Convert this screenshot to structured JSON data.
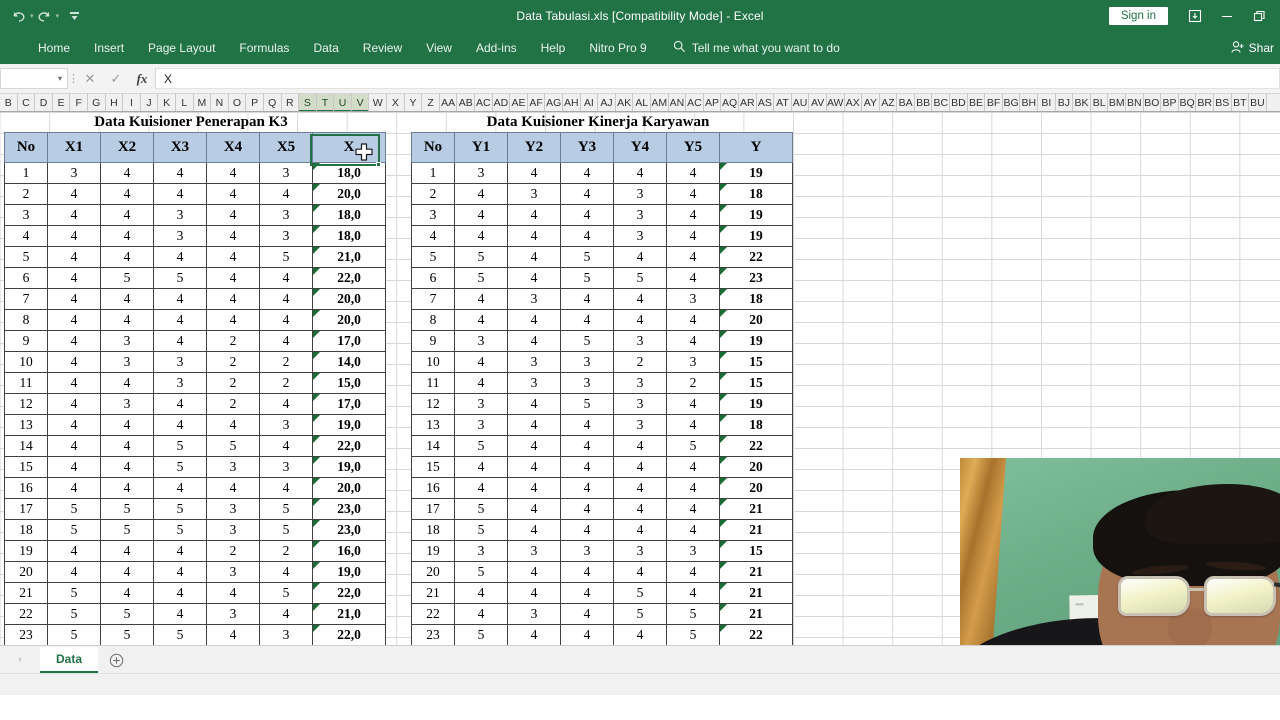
{
  "titlebar": {
    "document_title": "Data Tabulasi.xls  [Compatibility Mode]  -  Excel",
    "undo_icon": "↶",
    "redo_icon": "↷",
    "customize_icon": "�businessdown",
    "sign_in_label": "Sign in",
    "ribbon_display_icon": "ribbon-display-options",
    "minimize_icon": "minimize",
    "restore_icon": "restore"
  },
  "ribbon": {
    "tabs": [
      "Home",
      "Insert",
      "Page Layout",
      "Formulas",
      "Data",
      "Review",
      "View",
      "Add-ins",
      "Help",
      "Nitro Pro 9"
    ],
    "tell_me_placeholder": "Tell me what you want to do",
    "share_label": "Shar"
  },
  "formula_bar": {
    "name_box_value": "",
    "cancel_icon": "✕",
    "enter_icon": "✓",
    "fx_icon": "fx",
    "formula_value": "X"
  },
  "grid": {
    "column_headers": [
      "B",
      "C",
      "D",
      "E",
      "F",
      "G",
      "H",
      "I",
      "J",
      "K",
      "L",
      "M",
      "N",
      "O",
      "P",
      "Q",
      "R",
      "S",
      "T",
      "U",
      "V",
      "W",
      "X",
      "Y",
      "Z",
      "AA",
      "AB",
      "AC",
      "AD",
      "AE",
      "AF",
      "AG",
      "AH",
      "AI",
      "AJ",
      "AK",
      "AL",
      "AM",
      "AN",
      "AC",
      "AP",
      "AQ",
      "AR",
      "AS",
      "AT",
      "AU",
      "AV",
      "AW",
      "AX",
      "AY",
      "AZ",
      "BA",
      "BB",
      "BC",
      "BD",
      "BE",
      "BF",
      "BG",
      "BH",
      "BI",
      "BJ",
      "BK",
      "BL",
      "BM",
      "BN",
      "BO",
      "BP",
      "BQ",
      "BR",
      "BS",
      "BT",
      "BU"
    ],
    "selected_columns": [
      "S",
      "T",
      "U",
      "V"
    ],
    "selected_cell_text": "X"
  },
  "tables": [
    {
      "title": "Data Kuisioner Penerapan K3",
      "headers": [
        "No",
        "X1",
        "X2",
        "X3",
        "X4",
        "X5",
        "X"
      ],
      "total_style": "yellow",
      "rows": [
        [
          "1",
          "3",
          "4",
          "4",
          "4",
          "3",
          "18,0"
        ],
        [
          "2",
          "4",
          "4",
          "4",
          "4",
          "4",
          "20,0"
        ],
        [
          "3",
          "4",
          "4",
          "3",
          "4",
          "3",
          "18,0"
        ],
        [
          "4",
          "4",
          "4",
          "3",
          "4",
          "3",
          "18,0"
        ],
        [
          "5",
          "4",
          "4",
          "4",
          "4",
          "5",
          "21,0"
        ],
        [
          "6",
          "4",
          "5",
          "5",
          "4",
          "4",
          "22,0"
        ],
        [
          "7",
          "4",
          "4",
          "4",
          "4",
          "4",
          "20,0"
        ],
        [
          "8",
          "4",
          "4",
          "4",
          "4",
          "4",
          "20,0"
        ],
        [
          "9",
          "4",
          "3",
          "4",
          "2",
          "4",
          "17,0"
        ],
        [
          "10",
          "4",
          "3",
          "3",
          "2",
          "2",
          "14,0"
        ],
        [
          "11",
          "4",
          "4",
          "3",
          "2",
          "2",
          "15,0"
        ],
        [
          "12",
          "4",
          "3",
          "4",
          "2",
          "4",
          "17,0"
        ],
        [
          "13",
          "4",
          "4",
          "4",
          "4",
          "3",
          "19,0"
        ],
        [
          "14",
          "4",
          "4",
          "5",
          "5",
          "4",
          "22,0"
        ],
        [
          "15",
          "4",
          "4",
          "5",
          "3",
          "3",
          "19,0"
        ],
        [
          "16",
          "4",
          "4",
          "4",
          "4",
          "4",
          "20,0"
        ],
        [
          "17",
          "5",
          "5",
          "5",
          "3",
          "5",
          "23,0"
        ],
        [
          "18",
          "5",
          "5",
          "5",
          "3",
          "5",
          "23,0"
        ],
        [
          "19",
          "4",
          "4",
          "4",
          "2",
          "2",
          "16,0"
        ],
        [
          "20",
          "4",
          "4",
          "4",
          "3",
          "4",
          "19,0"
        ],
        [
          "21",
          "5",
          "4",
          "4",
          "4",
          "5",
          "22,0"
        ],
        [
          "22",
          "5",
          "5",
          "4",
          "3",
          "4",
          "21,0"
        ],
        [
          "23",
          "5",
          "5",
          "5",
          "4",
          "3",
          "22,0"
        ]
      ]
    },
    {
      "title": "Data Kuisioner Kinerja Karyawan",
      "headers": [
        "No",
        "Y1",
        "Y2",
        "Y3",
        "Y4",
        "Y5",
        "Y"
      ],
      "total_style": "green",
      "rows": [
        [
          "1",
          "3",
          "4",
          "4",
          "4",
          "4",
          "19"
        ],
        [
          "2",
          "4",
          "3",
          "4",
          "3",
          "4",
          "18"
        ],
        [
          "3",
          "4",
          "4",
          "4",
          "3",
          "4",
          "19"
        ],
        [
          "4",
          "4",
          "4",
          "4",
          "3",
          "4",
          "19"
        ],
        [
          "5",
          "5",
          "4",
          "5",
          "4",
          "4",
          "22"
        ],
        [
          "6",
          "5",
          "4",
          "5",
          "5",
          "4",
          "23"
        ],
        [
          "7",
          "4",
          "3",
          "4",
          "4",
          "3",
          "18"
        ],
        [
          "8",
          "4",
          "4",
          "4",
          "4",
          "4",
          "20"
        ],
        [
          "9",
          "3",
          "4",
          "5",
          "3",
          "4",
          "19"
        ],
        [
          "10",
          "4",
          "3",
          "3",
          "2",
          "3",
          "15"
        ],
        [
          "11",
          "4",
          "3",
          "3",
          "3",
          "2",
          "15"
        ],
        [
          "12",
          "3",
          "4",
          "5",
          "3",
          "4",
          "19"
        ],
        [
          "13",
          "3",
          "4",
          "4",
          "3",
          "4",
          "18"
        ],
        [
          "14",
          "5",
          "4",
          "4",
          "4",
          "5",
          "22"
        ],
        [
          "15",
          "4",
          "4",
          "4",
          "4",
          "4",
          "20"
        ],
        [
          "16",
          "4",
          "4",
          "4",
          "4",
          "4",
          "20"
        ],
        [
          "17",
          "5",
          "4",
          "4",
          "4",
          "4",
          "21"
        ],
        [
          "18",
          "5",
          "4",
          "4",
          "4",
          "4",
          "21"
        ],
        [
          "19",
          "3",
          "3",
          "3",
          "3",
          "3",
          "15"
        ],
        [
          "20",
          "5",
          "4",
          "4",
          "4",
          "4",
          "21"
        ],
        [
          "21",
          "4",
          "4",
          "4",
          "5",
          "4",
          "21"
        ],
        [
          "22",
          "4",
          "3",
          "4",
          "5",
          "5",
          "21"
        ],
        [
          "23",
          "5",
          "4",
          "4",
          "4",
          "5",
          "22"
        ]
      ]
    }
  ],
  "sheet_tabs": {
    "nav_icon": "›",
    "active_tab": "Data",
    "add_sheet_icon": "+"
  },
  "colors": {
    "excel_green": "#217346",
    "header_blue": "#b8cce4",
    "total_yellow": "#ffff00",
    "total_green": "#d9e6c5",
    "selection_green": "#217346"
  }
}
